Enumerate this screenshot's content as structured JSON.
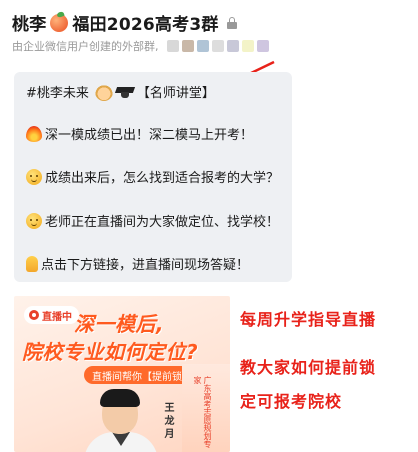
{
  "header": {
    "title_prefix": "桃李",
    "title_suffix": "福田2026高考3群",
    "subtitle": "由企业微信用户创建的外部群,",
    "blur_colors": [
      "#d8d8d8",
      "#c9b8a8",
      "#b0c4d6",
      "#dddddd",
      "#c8c8d8",
      "#f3f3c8",
      "#cfc6e0"
    ]
  },
  "message": {
    "line1_text": "#桃李未来",
    "line1_tag": "【名师讲堂】",
    "line2": "深一模成绩已出！深二模马上开考！",
    "line3": "成绩出来后，怎么找到适合报考的大学？",
    "line4": "老师正在直播间为大家做定位、找学校！",
    "line5": "点击下方链接，进直播间现场答疑！"
  },
  "promo": {
    "live_label": "直播中",
    "headline_1": "深一模后,",
    "headline_2": "院校专业如何定位?",
    "subline": "直播间帮你【提前锁定】",
    "vertical_text": "广东高考志愿规划专家",
    "teacher_name": "王龙月"
  },
  "captions": {
    "line1": "每周升学指导直播",
    "line2": "教大家如何提前锁",
    "line3": "定可报考院校"
  },
  "colors": {
    "accent_red": "#e8221a",
    "promo_orange": "#ff5a1f",
    "bubble_bg": "#eef0f3"
  }
}
